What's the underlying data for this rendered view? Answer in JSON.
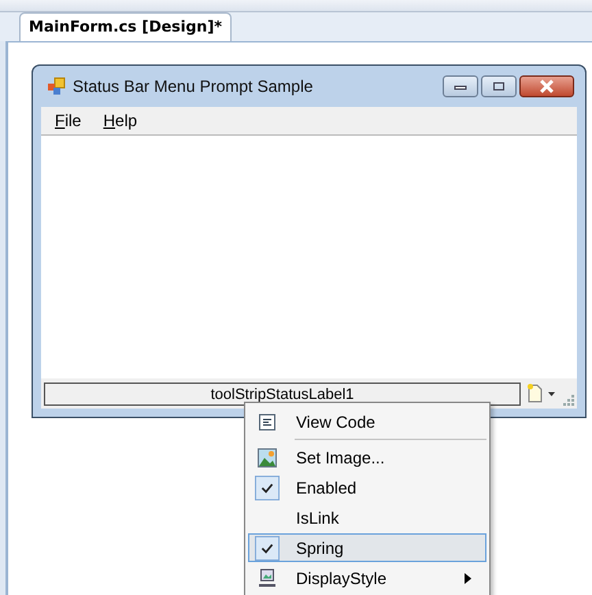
{
  "document_tab": {
    "label": "MainForm.cs [Design]*",
    "selected": true
  },
  "form": {
    "title": "Status Bar Menu Prompt Sample",
    "menu": [
      {
        "label": "File"
      },
      {
        "label": "Help"
      }
    ],
    "status_label": "toolStripStatusLabel1"
  },
  "context_menu": [
    {
      "kind": "code",
      "label": "View Code",
      "selected": false
    },
    {
      "kind": "separator"
    },
    {
      "kind": "image",
      "label": "Set Image...",
      "selected": false
    },
    {
      "kind": "toggle",
      "label": "Enabled",
      "checked": true,
      "selected": false
    },
    {
      "kind": "toggle",
      "label": "IsLink",
      "checked": false,
      "selected": false
    },
    {
      "kind": "toggle",
      "label": "Spring",
      "checked": true,
      "selected": true
    },
    {
      "kind": "submenu",
      "label": "DisplayStyle",
      "selected": false
    }
  ]
}
